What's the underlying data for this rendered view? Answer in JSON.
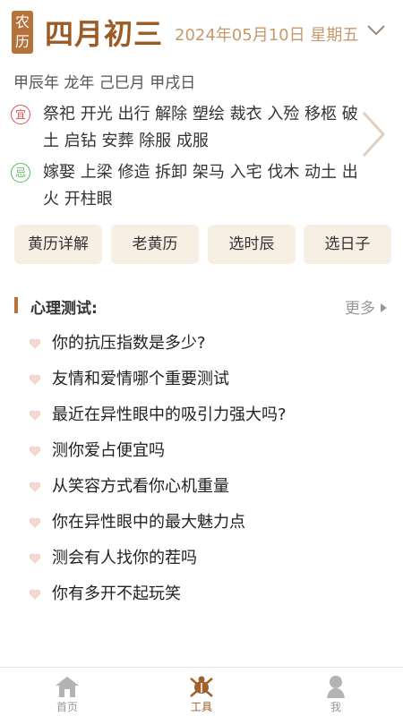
{
  "header": {
    "badge": "农历",
    "lunar_date": "四月初三",
    "solar_date": "2024年05月10日 星期五"
  },
  "ganzhi": "甲辰年 龙年 己巳月 甲戌日",
  "yi": {
    "icon": "宜",
    "text": "祭祀 开光 出行 解除 塑绘 裁衣 入殓 移柩 破土 启钻 安葬 除服 成服"
  },
  "ji": {
    "icon": "忌",
    "text": "嫁娶 上梁 修造 拆卸 架马 入宅 伐木 动土 出火 开柱眼"
  },
  "tools": [
    "黄历详解",
    "老黄历",
    "选时辰",
    "选日子"
  ],
  "section": {
    "title": "心理测试:",
    "more": "更多"
  },
  "tests": [
    "你的抗压指数是多少?",
    "友情和爱情哪个重要测试",
    "最近在异性眼中的吸引力强大吗?",
    "测你爱占便宜吗",
    "从笑容方式看你心机重量",
    "你在异性眼中的最大魅力点",
    "测会有人找你的茬吗",
    "你有多开不起玩笑"
  ],
  "tabs": [
    {
      "label": "首页",
      "icon": "home-icon"
    },
    {
      "label": "工具",
      "icon": "tools-icon"
    },
    {
      "label": "我",
      "icon": "profile-icon"
    }
  ],
  "colors": {
    "brand": "#9c5b25",
    "badge": "#b5733b",
    "tool_bg": "#f8efe4",
    "heart": "#f5d7cf",
    "yi": "#d9534f",
    "ji": "#5cb85c"
  }
}
